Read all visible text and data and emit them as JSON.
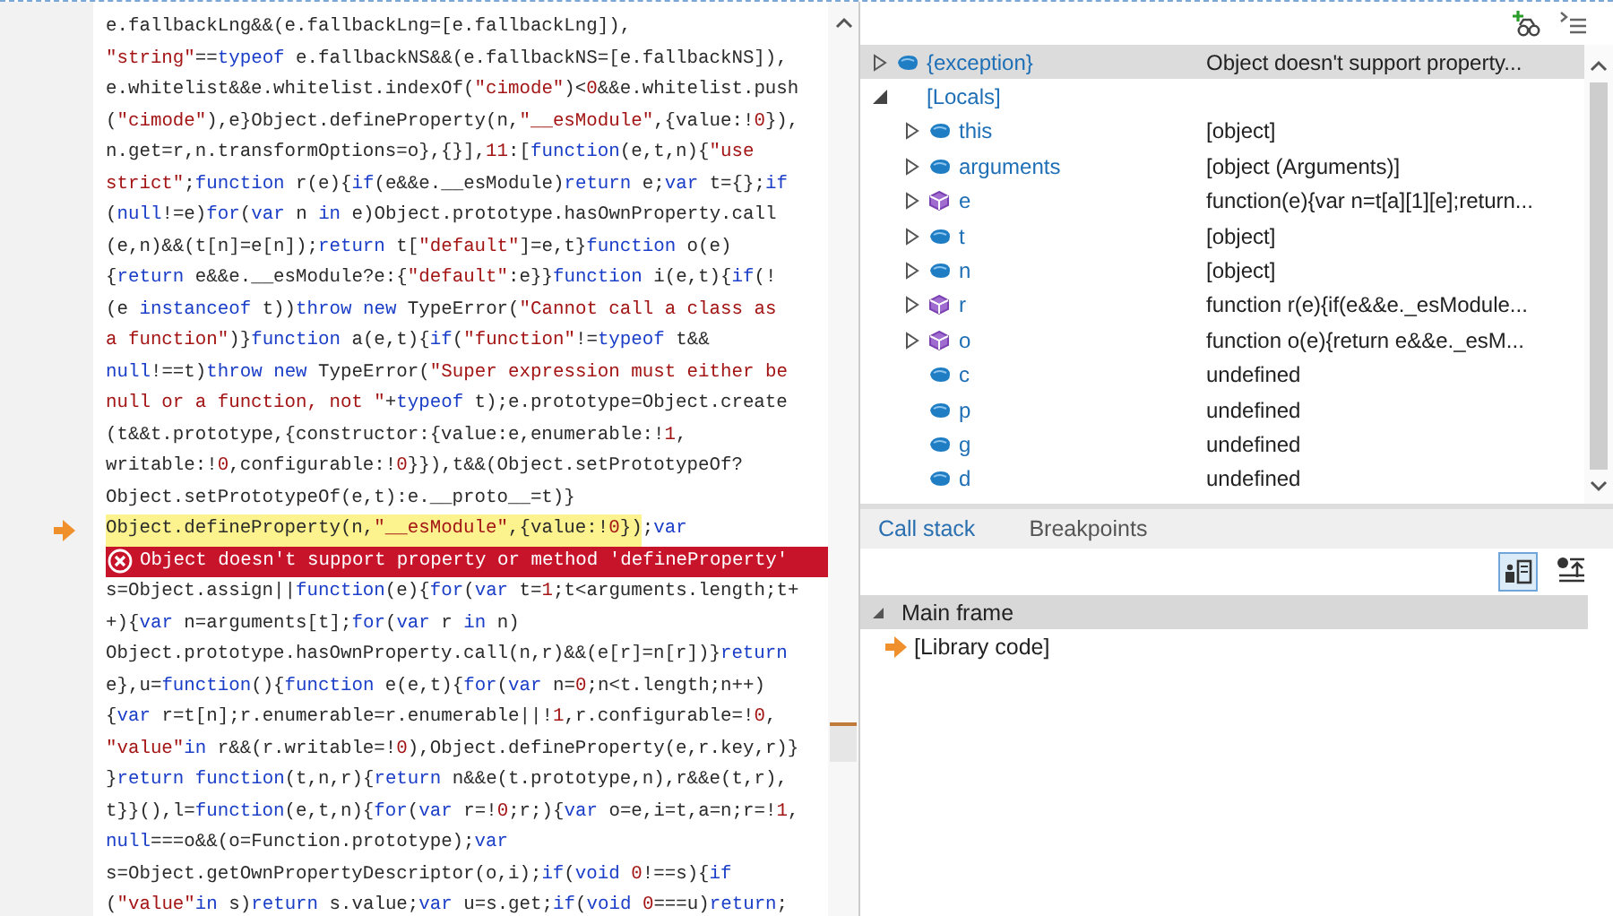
{
  "editor": {
    "lines": [
      {
        "kind": "code",
        "code": "e.fallbackLng&&(e.fallbackLng=[e.fallbackLng]),",
        "current": false
      },
      {
        "kind": "code",
        "code": "\"string\"==typeof e.fallbackNS&&(e.fallbackNS=[e.fallbackNS]),",
        "current": false
      },
      {
        "kind": "code",
        "code": "e.whitelist&&e.whitelist.indexOf(\"cimode\")<0&&e.whitelist.push",
        "current": false
      },
      {
        "kind": "code",
        "code": "(\"cimode\"),e}Object.defineProperty(n,\"__esModule\",{value:!0}),",
        "current": false
      },
      {
        "kind": "code",
        "code": "n.get=r,n.transformOptions=o},{}],11:[function(e,t,n){\"use",
        "current": false
      },
      {
        "kind": "code",
        "code": "strict\";function r(e){if(e&&e.__esModule)return e;var t={};if",
        "current": false
      },
      {
        "kind": "code",
        "code": "(null!=e)for(var n in e)Object.prototype.hasOwnProperty.call",
        "current": false
      },
      {
        "kind": "code",
        "code": "(e,n)&&(t[n]=e[n]);return t[\"default\"]=e,t}function o(e)",
        "current": false
      },
      {
        "kind": "code",
        "code": "{return e&&e.__esModule?e:{\"default\":e}}function i(e,t){if(!",
        "current": false
      },
      {
        "kind": "code",
        "code": "(e instanceof t))throw new TypeError(\"Cannot call a class as",
        "current": false
      },
      {
        "kind": "code",
        "code": "a function\")}function a(e,t){if(\"function\"!=typeof t&&",
        "current": false
      },
      {
        "kind": "code",
        "code": "null!==t)throw new TypeError(\"Super expression must either be",
        "current": false
      },
      {
        "kind": "code",
        "code": "null or a function, not \"+typeof t);e.prototype=Object.create",
        "current": false
      },
      {
        "kind": "code",
        "code": "(t&&t.prototype,{constructor:{value:e,enumerable:!1,",
        "current": false
      },
      {
        "kind": "code",
        "code": "writable:!0,configurable:!0}}),t&&(Object.setPrototypeOf?",
        "current": false
      },
      {
        "kind": "code",
        "code": "Object.setPrototypeOf(e,t):e.__proto__=t)}",
        "current": false
      },
      {
        "kind": "code",
        "code": "Object.defineProperty(n,\"__esModule\",{value:!0})",
        "after": ";var",
        "current": true
      },
      {
        "kind": "error",
        "message": "Object doesn't support property or method 'defineProperty'"
      },
      {
        "kind": "code",
        "code": "s=Object.assign||function(e){for(var t=1;t<arguments.length;t+",
        "current": false
      },
      {
        "kind": "code",
        "code": "+){var n=arguments[t];for(var r in n)",
        "current": false
      },
      {
        "kind": "code",
        "code": "Object.prototype.hasOwnProperty.call(n,r)&&(e[r]=n[r])}return",
        "current": false
      },
      {
        "kind": "code",
        "code": "e},u=function(){function e(e,t){for(var n=0;n<t.length;n++)",
        "current": false
      },
      {
        "kind": "code",
        "code": "{var r=t[n];r.enumerable=r.enumerable||!1,r.configurable=!0,",
        "current": false
      },
      {
        "kind": "code",
        "code": "\"value\"in r&&(r.writable=!0),Object.defineProperty(e,r.key,r)}",
        "current": false
      },
      {
        "kind": "code",
        "code": "}return function(t,n,r){return n&&e(t.prototype,n),r&&e(t,r),",
        "current": false
      },
      {
        "kind": "code",
        "code": "t}}(),l=function(e,t,n){for(var r=!0;r;){var o=e,i=t,a=n;r=!1,",
        "current": false
      },
      {
        "kind": "code",
        "code": "null===o&&(o=Function.prototype);var",
        "current": false
      },
      {
        "kind": "code",
        "code": "s=Object.getOwnPropertyDescriptor(o,i);if(void 0!==s){if",
        "current": false
      },
      {
        "kind": "code",
        "code": "(\"value\"in s)return s.value;var u=s.get;if(void 0===u)return;",
        "current": false
      }
    ]
  },
  "locals": {
    "rows": [
      {
        "name": "{exception}",
        "value": "Object doesn't support property...",
        "kind": "object",
        "has_children": true,
        "expanded": false,
        "selected": true
      },
      {
        "name": "[Locals]",
        "kind": "group",
        "has_children": true,
        "expanded": true,
        "selected": false,
        "children": [
          {
            "name": "this",
            "value": "[object]",
            "kind": "object",
            "has_children": true,
            "expanded": false,
            "selected": false
          },
          {
            "name": "arguments",
            "value": "[object (Arguments)]",
            "kind": "object",
            "has_children": true,
            "expanded": false,
            "selected": false
          },
          {
            "name": "e",
            "value": "function(e){var n=t[a][1][e];return...",
            "kind": "method",
            "has_children": true,
            "expanded": false,
            "selected": false
          },
          {
            "name": "t",
            "value": "[object]",
            "kind": "object",
            "has_children": true,
            "expanded": false,
            "selected": false
          },
          {
            "name": "n",
            "value": "[object]",
            "kind": "object",
            "has_children": true,
            "expanded": false,
            "selected": false
          },
          {
            "name": "r",
            "value": "function r(e){if(e&&e._esModule...",
            "kind": "method",
            "has_children": true,
            "expanded": false,
            "selected": false
          },
          {
            "name": "o",
            "value": "function o(e){return e&&e._esM...",
            "kind": "method",
            "has_children": true,
            "expanded": false,
            "selected": false
          },
          {
            "name": "c",
            "value": "undefined",
            "kind": "object",
            "has_children": false,
            "selected": false
          },
          {
            "name": "p",
            "value": "undefined",
            "kind": "object",
            "has_children": false,
            "selected": false
          },
          {
            "name": "g",
            "value": "undefined",
            "kind": "object",
            "has_children": false,
            "selected": false
          },
          {
            "name": "d",
            "value": "undefined",
            "kind": "object",
            "has_children": false,
            "selected": false
          }
        ]
      }
    ]
  },
  "bottom_panel": {
    "tabs": [
      {
        "label": "Call stack",
        "selected": true
      },
      {
        "label": "Breakpoints",
        "selected": false
      }
    ],
    "frames": [
      {
        "name": "Main frame",
        "expanded": true,
        "children": [
          {
            "name": "[Library code]",
            "current": true
          }
        ]
      }
    ]
  }
}
